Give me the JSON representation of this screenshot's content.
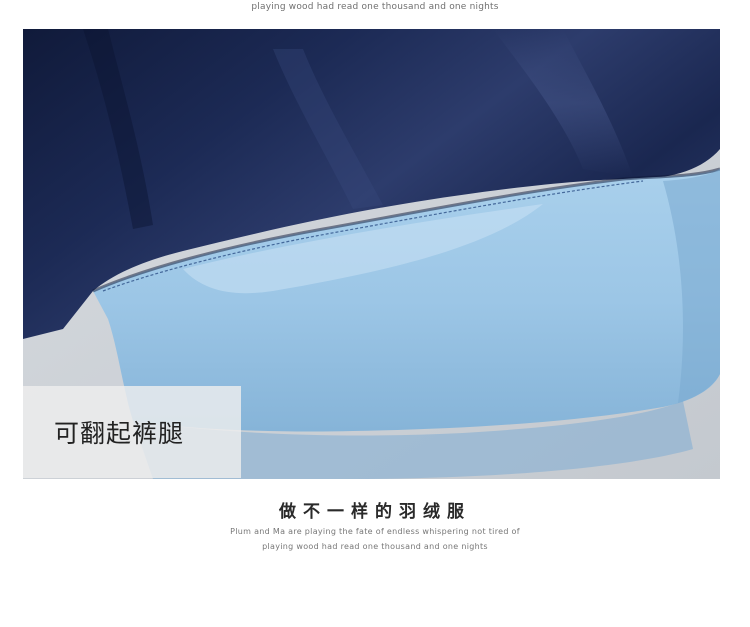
{
  "top_caption": "playing wood had read one thousand and one nights",
  "photo": {
    "overlay_label": "可翻起裤腿",
    "colors": {
      "navy_fabric": "#1c2a55",
      "navy_highlight": "#3f4f82",
      "lining_blue": "#9cc6e6",
      "lining_highlight": "#c6e0f3",
      "background": "#cfd4da"
    }
  },
  "headline": "做不一样的羽绒服",
  "caption_lines": [
    "Plum and Ma are playing the fate of endless whispering not tired of",
    "playing wood had read one thousand and one nights"
  ]
}
